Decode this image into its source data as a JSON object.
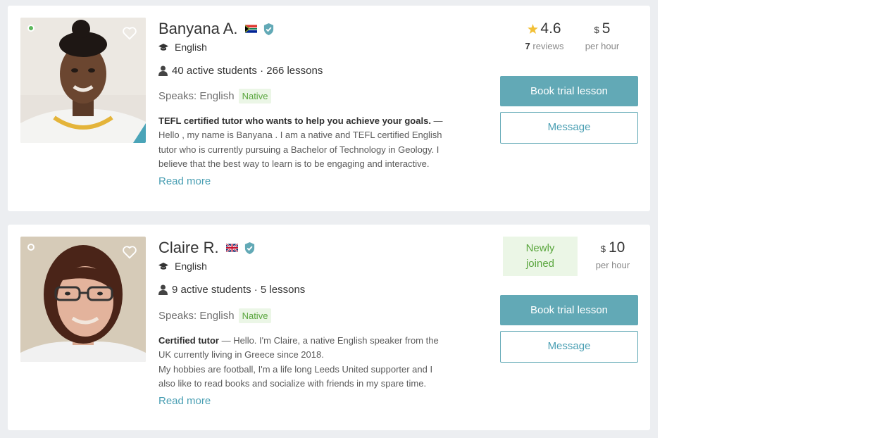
{
  "tutors": [
    {
      "name": "Banyana A.",
      "flag": "south-africa-flag-icon",
      "online": true,
      "subject": "English",
      "students": "40 active students",
      "lessons": "266 lessons",
      "speaks_label": "Speaks: English",
      "speaks_level": "Native",
      "headline": "TEFL certified tutor who wants to help you achieve your goals.",
      "about_lines": [
        "Hello , my name is Banyana . I am a native and TEFL certified English",
        "tutor who is currently pursuing a Bachelor of Technology in Geology. I",
        "believe that the best way to learn is to be engaging and interactive."
      ],
      "read_more": "Read more",
      "rating": "4.6",
      "reviews_count": "7",
      "reviews_label": "reviews",
      "currency": "$",
      "price": "5",
      "price_unit": "per hour",
      "book_label": "Book trial lesson",
      "message_label": "Message"
    },
    {
      "name": "Claire R.",
      "flag": "uk-flag-icon",
      "online": false,
      "subject": "English",
      "students": "9 active students",
      "lessons": "5 lessons",
      "speaks_label": "Speaks: English",
      "speaks_level": "Native",
      "headline": "Certified tutor",
      "about_lines": [
        "Hello. I'm Claire, a native English speaker from the",
        "UK currently living in Greece since 2018.",
        "My hobbies are football, I'm a life long Leeds United supporter and I",
        "also like to read books and socialize with friends in my spare time."
      ],
      "read_more": "Read more",
      "badge_line1": "Newly",
      "badge_line2": "joined",
      "currency": "$",
      "price": "10",
      "price_unit": "per hour",
      "book_label": "Book trial lesson",
      "message_label": "Message"
    }
  ],
  "dash_separator": " — ",
  "dot_separator": " · ",
  "colors": {
    "accent": "#62a9b6",
    "link": "#4a9fb3",
    "native_bg": "#ebf6e6",
    "native_text": "#5aa63e",
    "online": "#5cb85c",
    "star": "#f2c037",
    "background": "#eceef1"
  }
}
